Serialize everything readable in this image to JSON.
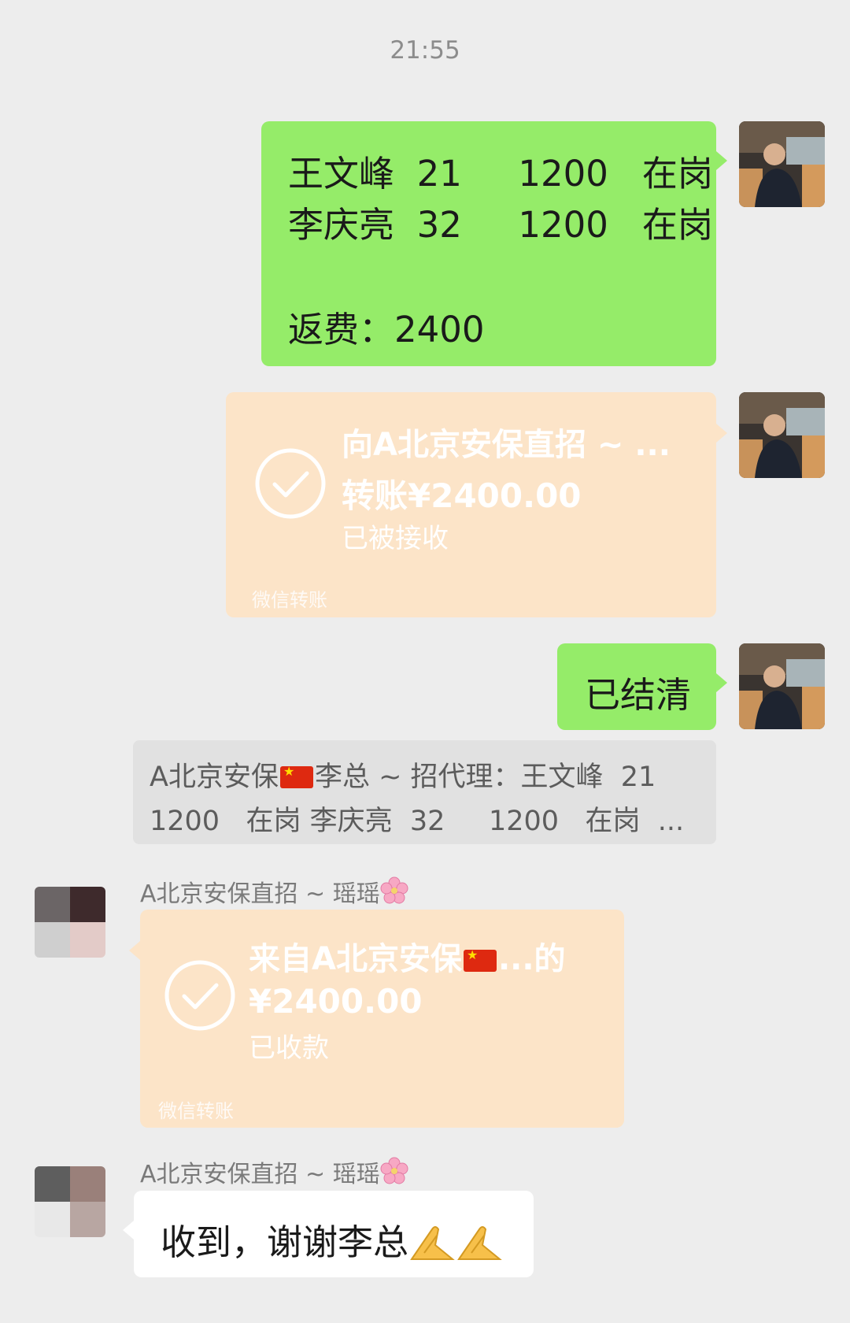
{
  "timestamp": "21:55",
  "msg1": {
    "line1": "王文峰  21     1200   在岗",
    "line2": "李庆亮  32     1200   在岗",
    "line3": "返费：2400"
  },
  "transfer1": {
    "title": "向A北京安保直招 ~ ...",
    "amount": "转账¥2400.00",
    "status": "已被接收",
    "footer": "微信转账"
  },
  "msg2": {
    "text": "已结清"
  },
  "quote": {
    "line1_a": "A北京安保",
    "line1_b": "李总 ~ 招代理：王文峰  21",
    "line2": "1200   在岗 李庆亮  32     1200   在岗  ..."
  },
  "sender_name": {
    "prefix": "A北京安保直招 ~ 瑶瑶"
  },
  "transfer2": {
    "title_a": "来自A北京安保",
    "title_b": "...的",
    "amount": "¥2400.00",
    "status": "已收款",
    "footer": "微信转账"
  },
  "msg3": {
    "text": "收到，谢谢李总"
  },
  "colors": {
    "self_bubble": "#95ec69",
    "transfer_card": "#fce4c8",
    "background": "#ededed",
    "quote_bg": "#e1e1e1"
  },
  "icons": {
    "transfer_check": "check-circle-icon",
    "flag": "china-flag-icon",
    "blossom": "cherry-blossom-icon",
    "hands": "folded-hands-icon"
  }
}
